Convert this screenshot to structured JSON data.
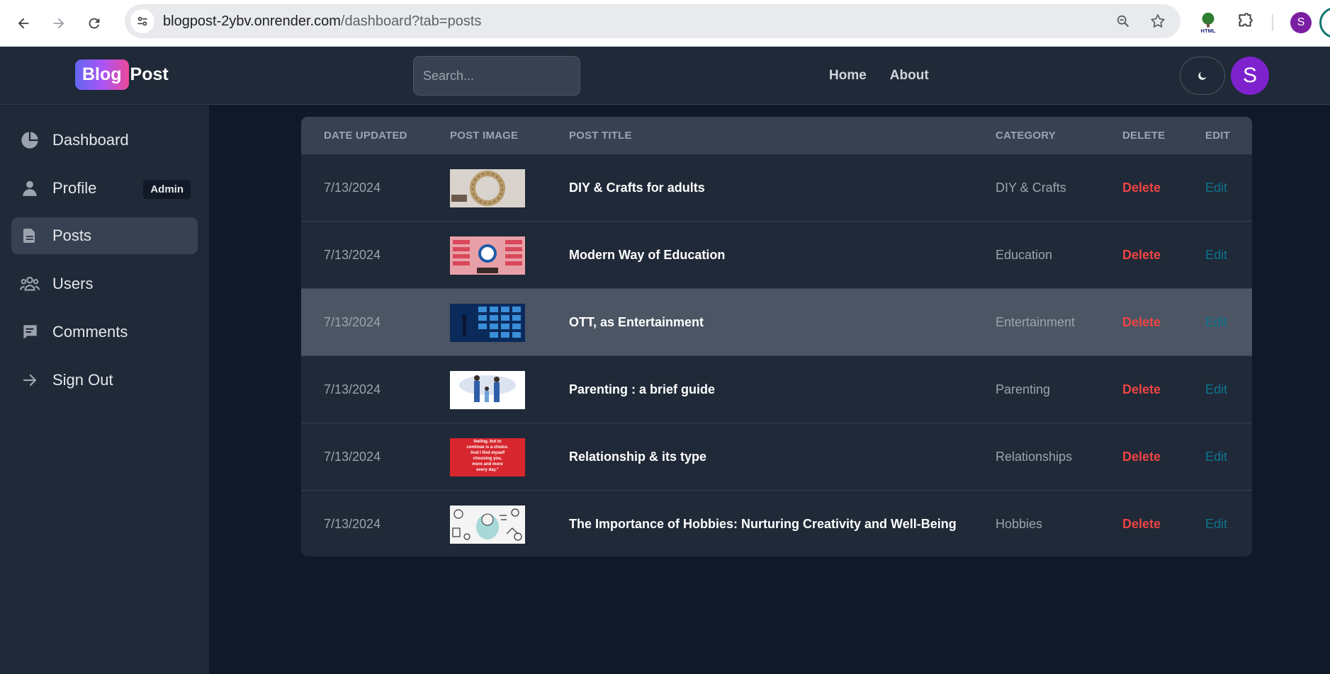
{
  "browser": {
    "url_domain": "blogpost-2ybv.onrender.com",
    "url_path": "/dashboard?tab=posts",
    "profile_initial": "S",
    "ext_label": "HTML"
  },
  "header": {
    "logo_badge": "Blog",
    "logo_text": "Post",
    "search_placeholder": "Search...",
    "nav": [
      "Home",
      "About"
    ],
    "avatar_initial": "S"
  },
  "sidebar": {
    "items": [
      {
        "label": "Dashboard",
        "icon": "pie-chart-icon"
      },
      {
        "label": "Profile",
        "icon": "user-icon",
        "badge": "Admin"
      },
      {
        "label": "Posts",
        "icon": "document-icon",
        "active": true
      },
      {
        "label": "Users",
        "icon": "users-group-icon"
      },
      {
        "label": "Comments",
        "icon": "comment-icon"
      },
      {
        "label": "Sign Out",
        "icon": "arrow-right-icon"
      }
    ]
  },
  "table": {
    "headers": [
      "DATE UPDATED",
      "POST IMAGE",
      "POST TITLE",
      "CATEGORY",
      "DELETE",
      "EDIT"
    ],
    "rows": [
      {
        "date": "7/13/2024",
        "title": "DIY & Crafts for adults",
        "category": "DIY & Crafts",
        "delete": "Delete",
        "edit": "Edit",
        "image": "wreath"
      },
      {
        "date": "7/13/2024",
        "title": "Modern Way of Education",
        "category": "Education",
        "delete": "Delete",
        "edit": "Edit",
        "image": "mindmap"
      },
      {
        "date": "7/13/2024",
        "title": "OTT, as Entertainment",
        "category": "Entertainment",
        "delete": "Delete",
        "edit": "Edit",
        "image": "screens"
      },
      {
        "date": "7/13/2024",
        "title": "Parenting : a brief guide",
        "category": "Parenting",
        "delete": "Delete",
        "edit": "Edit",
        "image": "family"
      },
      {
        "date": "7/13/2024",
        "title": "Relationship & its type",
        "category": "Relationships",
        "delete": "Delete",
        "edit": "Edit",
        "image": "quote",
        "image_text": [
          "feeling, but to",
          "continue is a choice.",
          "And I find myself",
          "choosing you,",
          "more and more",
          "every day.\""
        ]
      },
      {
        "date": "7/13/2024",
        "title": "The Importance of Hobbies: Nurturing Creativity and Well-Being",
        "category": "Hobbies",
        "delete": "Delete",
        "edit": "Edit",
        "image": "doodles"
      }
    ]
  },
  "colors": {
    "delete": "#ef4444",
    "edit": "#0e7490",
    "avatar": "#7e22ce"
  }
}
